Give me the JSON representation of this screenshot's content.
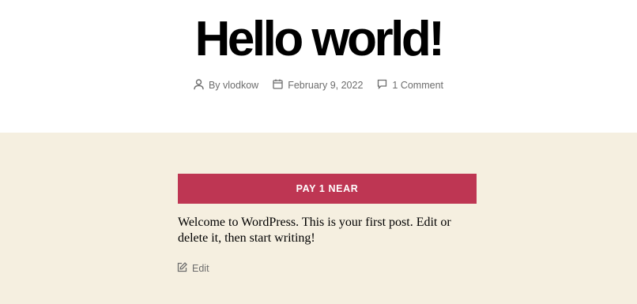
{
  "post": {
    "title": "Hello world!",
    "author_label": "By vlodkow",
    "date": "February 9, 2022",
    "comments": "1 Comment"
  },
  "content": {
    "pay_button_label": "PAY 1 NEAR",
    "body_text": "Welcome to WordPress. This is your first post. Edit or delete it, then start writing!",
    "edit_label": "Edit"
  },
  "icons": {
    "author": "user-icon",
    "date": "calendar-icon",
    "comments": "comment-icon",
    "edit": "edit-icon"
  },
  "colors": {
    "header_bg": "#ffffff",
    "content_bg": "#f5efe0",
    "button_bg": "#be3653",
    "button_text": "#ffffff",
    "meta_text": "#6d6d6d"
  }
}
